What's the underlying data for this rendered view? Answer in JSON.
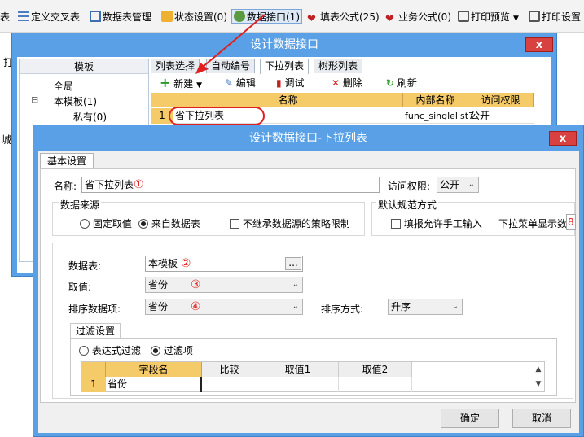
{
  "toolbar": {
    "items": [
      {
        "label": "表"
      },
      {
        "label": "定义交叉表"
      },
      {
        "label": "数据表管理"
      },
      {
        "label": "状态设置(0)"
      },
      {
        "label": "数据接口(1)"
      },
      {
        "label": "填表公式(25)"
      },
      {
        "label": "业务公式(0)"
      },
      {
        "label": "打印预览"
      },
      {
        "label": "打印设置"
      }
    ]
  },
  "side_fragments": {
    "top": "打",
    "mid": "城"
  },
  "dialog1": {
    "title": "设计数据接口",
    "close": "x",
    "left_header": "模板",
    "tree": [
      {
        "toggle": "",
        "label": "全局"
      },
      {
        "toggle": "⊟",
        "label": "本模板(1)"
      },
      {
        "toggle": "",
        "label": "私有(0)"
      }
    ],
    "tabs": [
      "列表选择",
      "自动编号",
      "下拉列表",
      "树形列表"
    ],
    "actions": {
      "new": "新建",
      "edit": "编辑",
      "debug": "调试",
      "delete": "删除",
      "refresh": "刷新"
    },
    "grid": {
      "headers": [
        "名称",
        "内部名称",
        "访问权限"
      ],
      "rows": [
        {
          "num": "1",
          "name": "省下拉列表",
          "internal": "func_singlelist7",
          "access": "公开"
        }
      ]
    }
  },
  "dialog2": {
    "title": "设计数据接口-下拉列表",
    "close": "x",
    "tab": "基本设置",
    "name_label": "名称:",
    "name_value": "省下拉列表",
    "mark1": "①",
    "access_label": "访问权限:",
    "access_value": "公开",
    "source_group": "数据来源",
    "radio_fixed": "固定取值",
    "radio_table": "来自数据表",
    "check_inherit": "不继承数据源的策略限制",
    "norm_group": "默认规范方式",
    "check_manual": "填报允许手工输入",
    "dropdown_count_label": "下拉菜单显示数",
    "dropdown_count_value": "8",
    "table_label": "数据表:",
    "table_value": "本模板",
    "browse": "...",
    "mark2": "②",
    "value_label": "取值:",
    "value_value": "省份",
    "mark3": "③",
    "sortfield_label": "排序数据项:",
    "sortfield_value": "省份",
    "mark4": "④",
    "sortmode_label": "排序方式:",
    "sortmode_value": "升序",
    "filter_tab": "过滤设置",
    "radio_expr": "表达式过滤",
    "radio_item": "过滤项",
    "filter_grid": {
      "headers": [
        "字段名",
        "比较",
        "取值1",
        "取值2"
      ],
      "rows": [
        {
          "num": "1",
          "field": "省份",
          "compare": "",
          "v1": "",
          "v2": ""
        }
      ]
    },
    "ok": "确定",
    "cancel": "取消"
  },
  "colors": {
    "dialog_frame": "#5aa0e6",
    "close_button": "#d94040",
    "grid_header": "#f5ca69",
    "annotation_red": "#e02020"
  }
}
